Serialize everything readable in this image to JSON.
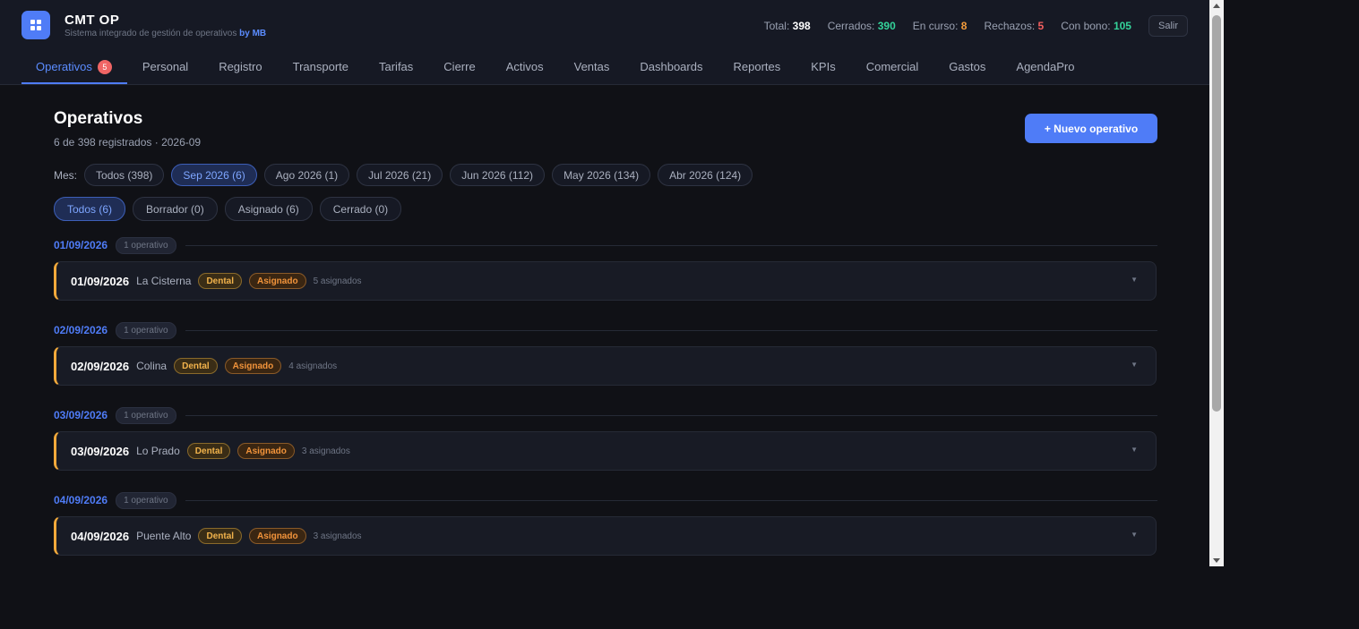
{
  "app": {
    "title": "CMT OP",
    "subtitle": "Sistema integrado de gestión de operativos",
    "by": "by MB",
    "logo_icon": "grid-icon",
    "accent": "#4f7cf7"
  },
  "stats": [
    {
      "label": "Total:",
      "value": "398",
      "color": "#ffffff"
    },
    {
      "label": "Cerrados:",
      "value": "390",
      "color": "#34d39a"
    },
    {
      "label": "En curso:",
      "value": "8",
      "color": "#f39b3b"
    },
    {
      "label": "Rechazos:",
      "value": "5",
      "color": "#f25f5f"
    },
    {
      "label": "Con bono:",
      "value": "105",
      "color": "#34d39a"
    }
  ],
  "logout_label": "Salir",
  "nav": [
    {
      "label": "Operativos",
      "badge": "5",
      "active": true
    },
    {
      "label": "Personal"
    },
    {
      "label": "Registro"
    },
    {
      "label": "Transporte"
    },
    {
      "label": "Tarifas"
    },
    {
      "label": "Cierre"
    },
    {
      "label": "Activos"
    },
    {
      "label": "Ventas"
    },
    {
      "label": "Dashboards"
    },
    {
      "label": "Reportes"
    },
    {
      "label": "KPIs"
    },
    {
      "label": "Comercial"
    },
    {
      "label": "Gastos"
    },
    {
      "label": "AgendaPro"
    }
  ],
  "page": {
    "title": "Operativos",
    "subtitle": "6 de 398 registrados · 2026-09",
    "new_button": "+ Nuevo operativo"
  },
  "month_filter": {
    "label": "Mes:",
    "options": [
      {
        "label": "Todos (398)",
        "active": false
      },
      {
        "label": "Sep 2026 (6)",
        "active": true
      },
      {
        "label": "Ago 2026 (1)",
        "active": false
      },
      {
        "label": "Jul 2026 (21)",
        "active": false
      },
      {
        "label": "Jun 2026 (112)",
        "active": false
      },
      {
        "label": "May 2026 (134)",
        "active": false
      },
      {
        "label": "Abr 2026 (124)",
        "active": false
      }
    ]
  },
  "status_filter": [
    {
      "label": "Todos (6)",
      "active": true
    },
    {
      "label": "Borrador (0)",
      "active": false
    },
    {
      "label": "Asignado (6)",
      "active": false
    },
    {
      "label": "Cerrado (0)",
      "active": false
    }
  ],
  "groups": [
    {
      "date": "01/09/2026",
      "count": "1 operativo",
      "card": {
        "date": "01/09/2026",
        "place": "La Cisterna",
        "type": "Dental",
        "status": "Asignado",
        "assigned": "5 asignados"
      }
    },
    {
      "date": "02/09/2026",
      "count": "1 operativo",
      "card": {
        "date": "02/09/2026",
        "place": "Colina",
        "type": "Dental",
        "status": "Asignado",
        "assigned": "4 asignados"
      }
    },
    {
      "date": "03/09/2026",
      "count": "1 operativo",
      "card": {
        "date": "03/09/2026",
        "place": "Lo Prado",
        "type": "Dental",
        "status": "Asignado",
        "assigned": "3 asignados"
      }
    },
    {
      "date": "04/09/2026",
      "count": "1 operativo",
      "card": {
        "date": "04/09/2026",
        "place": "Puente Alto",
        "type": "Dental",
        "status": "Asignado",
        "assigned": "3 asignados"
      }
    }
  ]
}
